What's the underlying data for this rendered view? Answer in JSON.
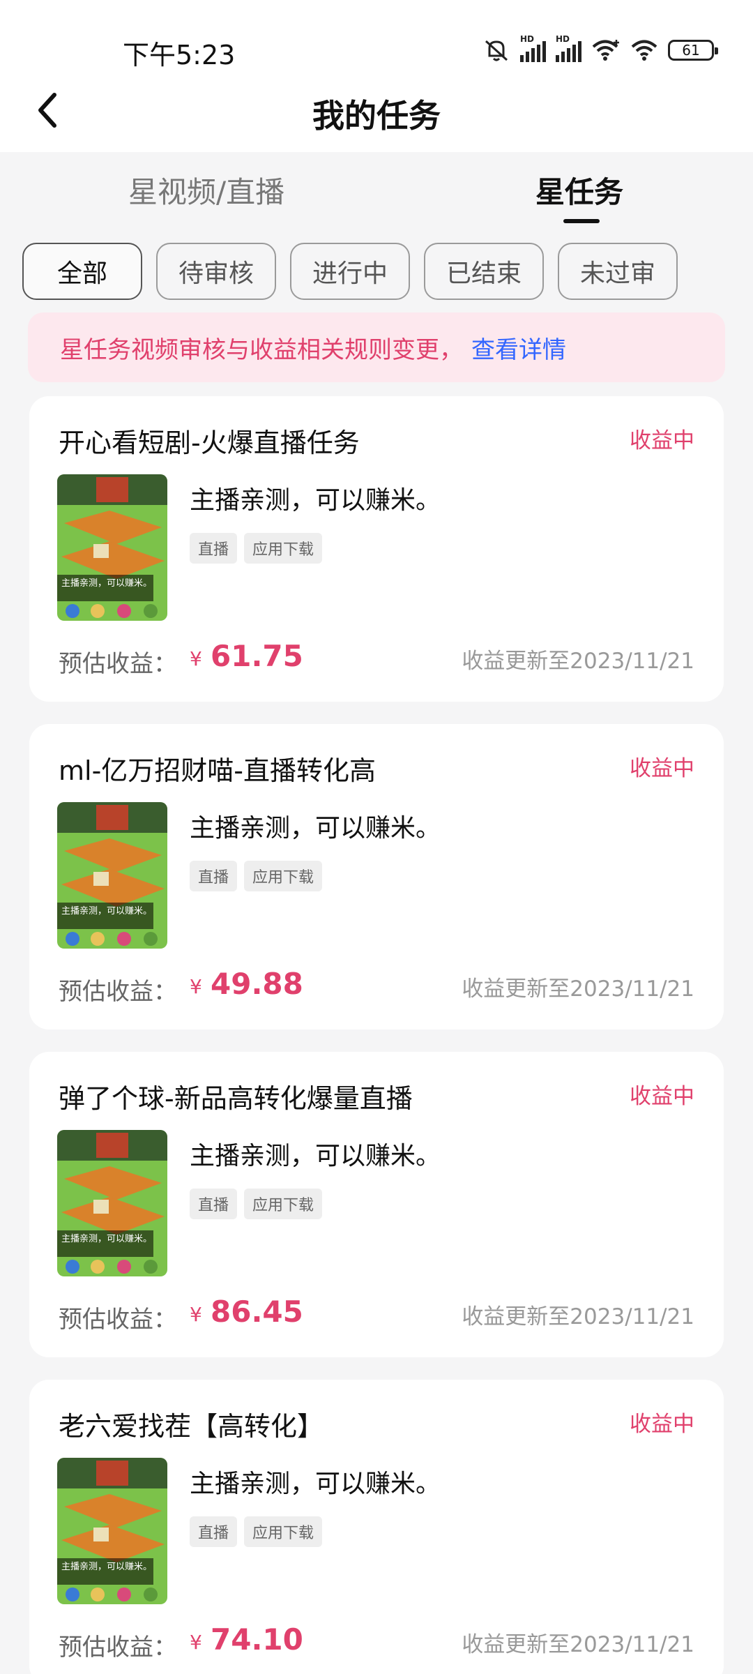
{
  "status_bar": {
    "time": "下午5:23",
    "battery": "61",
    "signal_labels": [
      "HD",
      "HD"
    ],
    "icons": [
      "mute-icon",
      "signal-icon",
      "signal-icon",
      "wifi-plus-icon",
      "wifi-icon",
      "battery-icon"
    ]
  },
  "header": {
    "title": "我的任务",
    "back_icon": "chevron-left-icon"
  },
  "tabs": [
    {
      "label": "星视频/直播",
      "active": false
    },
    {
      "label": "星任务",
      "active": true
    }
  ],
  "filters": [
    {
      "label": "全部",
      "active": true
    },
    {
      "label": "待审核",
      "active": false
    },
    {
      "label": "进行中",
      "active": false
    },
    {
      "label": "已结束",
      "active": false
    },
    {
      "label": "未过审",
      "active": false
    }
  ],
  "notice": {
    "text": "星任务视频审核与收益相关规则变更，",
    "link": "查看详情"
  },
  "tasks": [
    {
      "title": "开心看短剧-火爆直播任务",
      "status": "收益中",
      "thumb_caption": "主播亲测，可以赚米。",
      "description": "主播亲测，可以赚米。",
      "tags": [
        "直播",
        "应用下载"
      ],
      "earn_label": "预估收益：",
      "currency": "¥",
      "amount": "61.75",
      "updated": "收益更新至2023/11/21"
    },
    {
      "title": "ml-亿万招财喵-直播转化高",
      "status": "收益中",
      "thumb_caption": "主播亲测，可以赚米。",
      "description": "主播亲测，可以赚米。",
      "tags": [
        "直播",
        "应用下载"
      ],
      "earn_label": "预估收益：",
      "currency": "¥",
      "amount": "49.88",
      "updated": "收益更新至2023/11/21"
    },
    {
      "title": "弹了个球-新品高转化爆量直播",
      "status": "收益中",
      "thumb_caption": "主播亲测，可以赚米。",
      "description": "主播亲测，可以赚米。",
      "tags": [
        "直播",
        "应用下载"
      ],
      "earn_label": "预估收益：",
      "currency": "¥",
      "amount": "86.45",
      "updated": "收益更新至2023/11/21"
    },
    {
      "title": "老六爱找茬【高转化】",
      "status": "收益中",
      "thumb_caption": "主播亲测，可以赚米。",
      "description": "主播亲测，可以赚米。",
      "tags": [
        "直播",
        "应用下载"
      ],
      "earn_label": "预估收益：",
      "currency": "¥",
      "amount": "74.10",
      "updated": "收益更新至2023/11/21"
    }
  ],
  "colors": {
    "accent": "#e0406c",
    "link": "#3366ff",
    "notice_bg": "#fde8ee",
    "page_bg": "#f5f5f6"
  }
}
